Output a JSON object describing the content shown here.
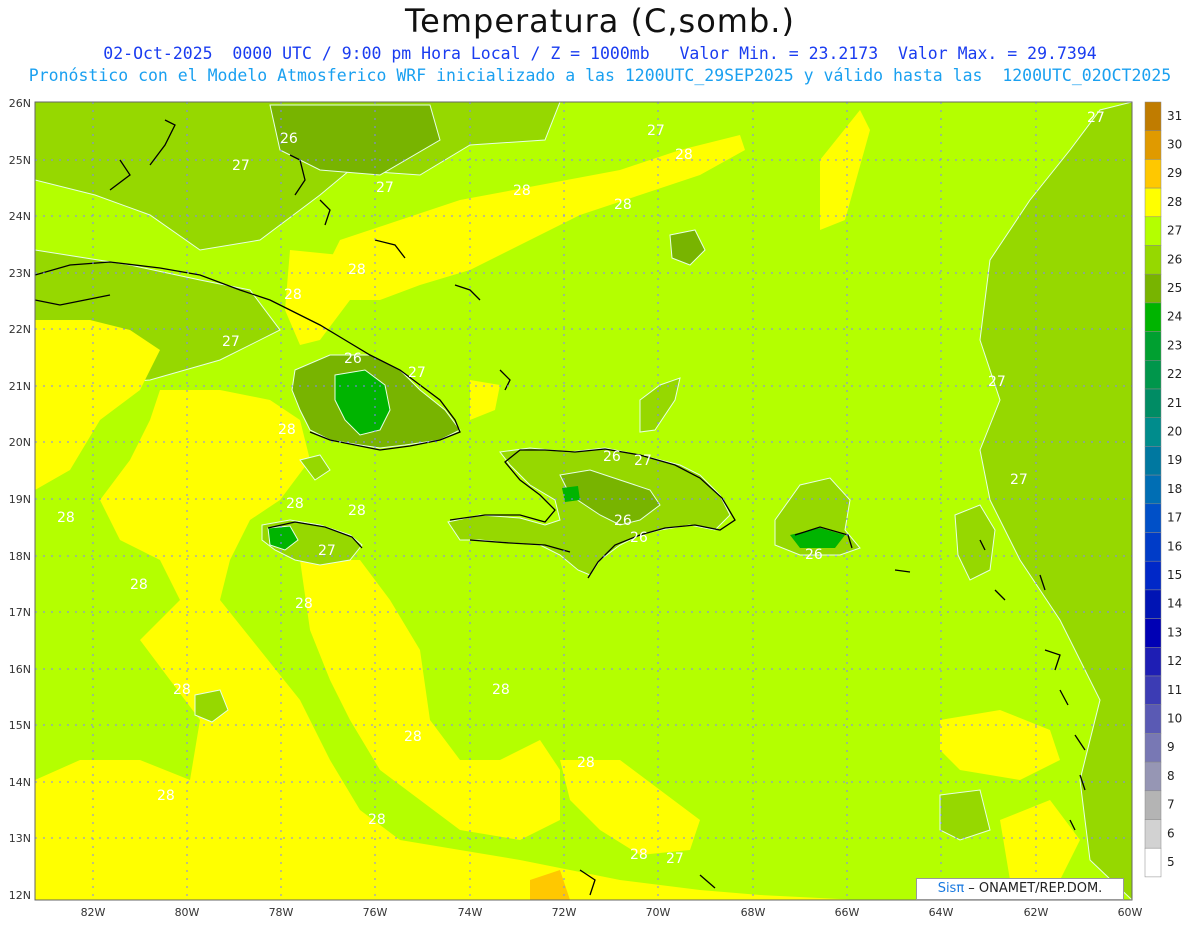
{
  "title": "Temperatura (C,somb.)",
  "subtitle_line1": "02-Oct-2025  0000 UTC / 9:00 pm Hora Local / Z = 1000mb   Valor Min. = 23.2173  Valor Max. = 29.7394",
  "subtitle_line2": "Pronóstico con el Modelo Atmosferico WRF inicializado a las 1200UTC_29SEP2025 y válido hasta las  1200UTC_02OCT2025",
  "credit": {
    "brand": "Sisπ",
    "text": " – ONAMET/REP.DOM."
  },
  "axes": {
    "lon_labels": [
      "82W",
      "80W",
      "78W",
      "76W",
      "74W",
      "72W",
      "70W",
      "68W",
      "66W",
      "64W",
      "62W",
      "60W"
    ],
    "lat_labels": [
      "26N",
      "25N",
      "24N",
      "23N",
      "22N",
      "21N",
      "20N",
      "19N",
      "18N",
      "17N",
      "16N",
      "15N",
      "14N",
      "13N",
      "12N"
    ]
  },
  "colorbar": {
    "labels": [
      "31",
      "30",
      "29",
      "28",
      "27",
      "26",
      "25",
      "24",
      "23",
      "22",
      "21",
      "20",
      "19",
      "18",
      "17",
      "16",
      "15",
      "14",
      "13",
      "12",
      "11",
      "10",
      "9",
      "8",
      "7",
      "6",
      "5"
    ],
    "colors": [
      "#c07c00",
      "#e09a00",
      "#ffc800",
      "#ffff00",
      "#b4ff00",
      "#96d800",
      "#78b400",
      "#00b400",
      "#00a030",
      "#00964b",
      "#008c64",
      "#008c8c",
      "#0078a0",
      "#006eb4",
      "#0050c8",
      "#003cc8",
      "#0028c8",
      "#0014b4",
      "#0000b4",
      "#1e1eb4",
      "#3c3cb4",
      "#5a5ab4",
      "#7878b4",
      "#9696b4",
      "#b4b4b4",
      "#d2d2d2",
      "#ffffff"
    ]
  },
  "contour_labels": [
    {
      "text": "26"
    },
    {
      "text": "27"
    },
    {
      "text": "27"
    },
    {
      "text": "28"
    },
    {
      "text": "28"
    },
    {
      "text": "27"
    },
    {
      "text": "28"
    },
    {
      "text": "27"
    },
    {
      "text": "28"
    },
    {
      "text": "28"
    },
    {
      "text": "27"
    },
    {
      "text": "26"
    },
    {
      "text": "27"
    },
    {
      "text": "28"
    },
    {
      "text": "26"
    },
    {
      "text": "27"
    },
    {
      "text": "26"
    },
    {
      "text": "26"
    },
    {
      "text": "26"
    },
    {
      "text": "27"
    },
    {
      "text": "27"
    },
    {
      "text": "28"
    },
    {
      "text": "28"
    },
    {
      "text": "27"
    },
    {
      "text": "28"
    },
    {
      "text": "28"
    },
    {
      "text": "28"
    },
    {
      "text": "28"
    },
    {
      "text": "28"
    },
    {
      "text": "28"
    },
    {
      "text": "28"
    },
    {
      "text": "28"
    },
    {
      "text": "28"
    },
    {
      "text": "28"
    },
    {
      "text": "27"
    }
  ]
}
